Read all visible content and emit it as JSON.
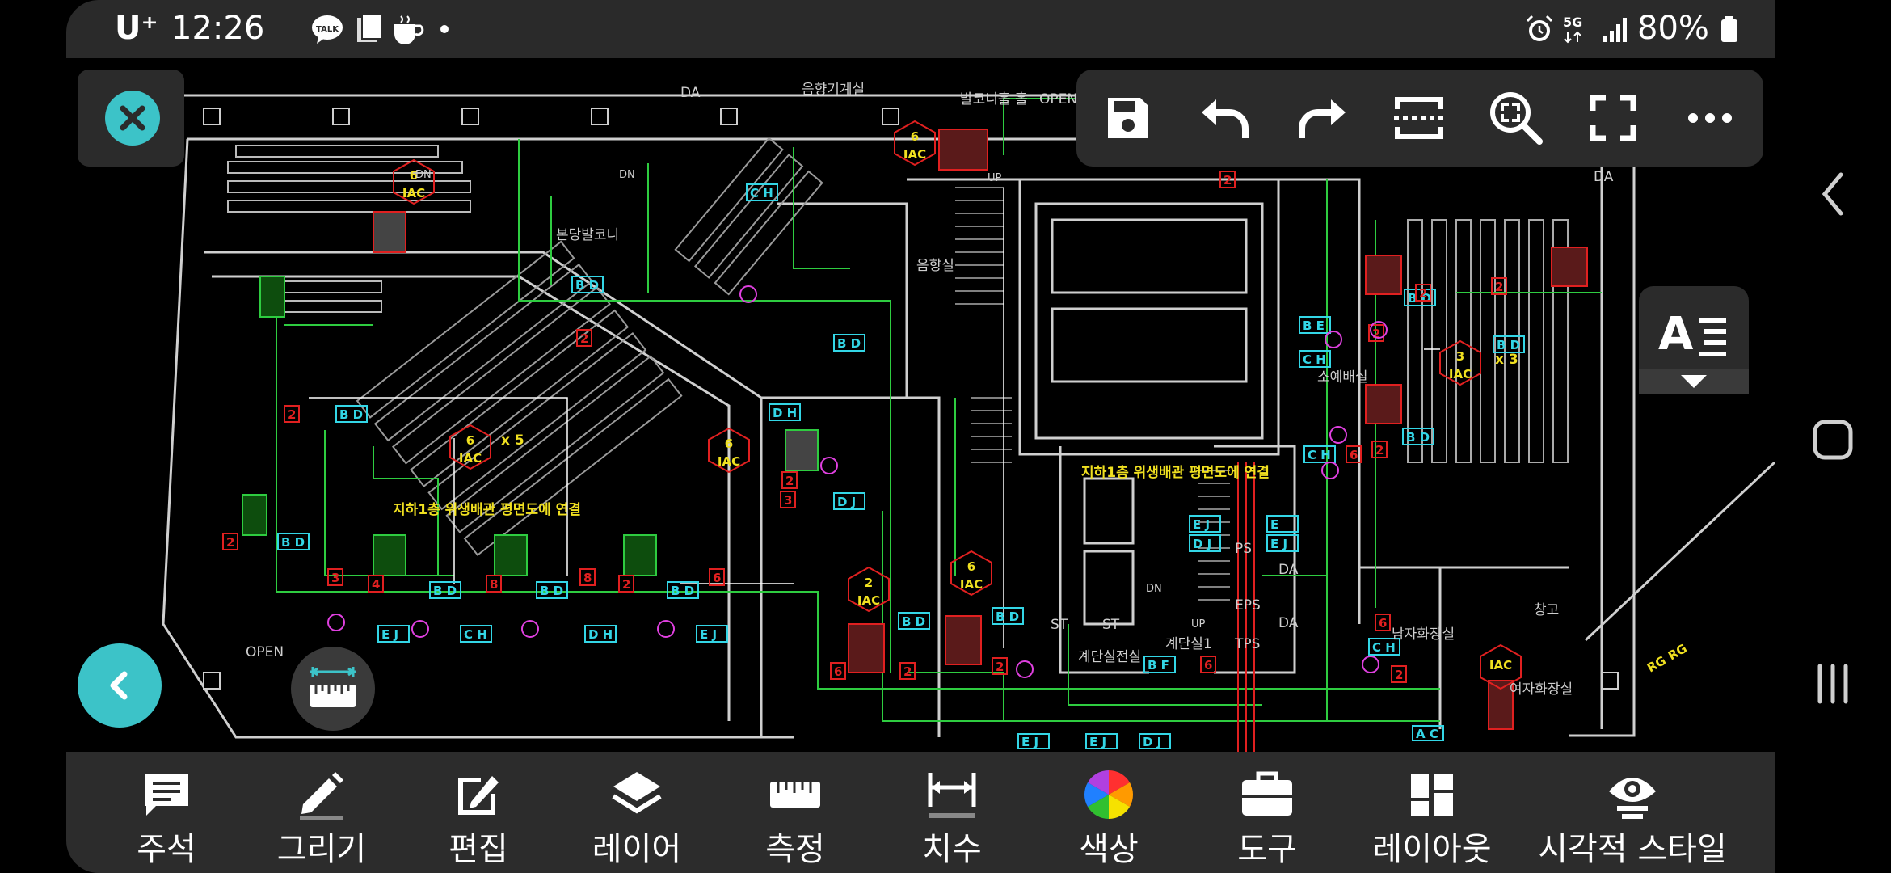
{
  "status_bar": {
    "carrier": "U⁺",
    "time": "12:26",
    "talk_badge": "TALK",
    "network": "5G",
    "battery": "80%"
  },
  "drawing": {
    "labels": {
      "da_top": "DA",
      "sound_control": "음향기계실",
      "balcony_hall": "발코니홀 홀",
      "open_top": "OPEN",
      "main_balcony": "본당발코니",
      "sound_room": "음향실",
      "link_note_left": "지하1층 위생배관 평면도에 연결",
      "link_note_center": "지하1층 위생배관 평면도에 연결",
      "x5": "x 5",
      "x3": "x 3",
      "open_bottom": "OPEN",
      "st1": "ST",
      "st2": "ST",
      "eps": "EPS",
      "tps": "TPS",
      "ps": "PS",
      "da_right": "DA",
      "da_r2": "DA",
      "da_r3": "DA",
      "stair_room": "계단실1",
      "power_room": "계단실전실",
      "water_room": "소예배실",
      "men_restroom": "남자화장실",
      "women_restroom": "여자화장실",
      "storage": "창고",
      "up": "UP",
      "dn": "DN",
      "iac": "IAC",
      "rg": "RG"
    }
  },
  "toolbar": {
    "save": "save",
    "undo": "undo",
    "redo": "redo",
    "fit": "fit-width",
    "zoom": "zoom-region",
    "fullscreen": "fullscreen",
    "more": "more"
  },
  "bottom_menu": [
    {
      "label": "주석",
      "icon": "comment-icon"
    },
    {
      "label": "그리기",
      "icon": "pencil-icon"
    },
    {
      "label": "편집",
      "icon": "edit-icon"
    },
    {
      "label": "레이어",
      "icon": "layers-icon"
    },
    {
      "label": "측정",
      "icon": "ruler-icon"
    },
    {
      "label": "치수",
      "icon": "dimension-icon"
    },
    {
      "label": "색상",
      "icon": "color-wheel-icon"
    },
    {
      "label": "도구",
      "icon": "toolbox-icon"
    },
    {
      "label": "레이아웃",
      "icon": "layout-icon"
    },
    {
      "label": "시각적 스타일",
      "icon": "visual-style-icon"
    }
  ],
  "colors": {
    "accent": "#3cc3c8",
    "panel": "#2b2b2b",
    "cad_green": "#2ecc40",
    "cad_red": "#e02020",
    "cad_cyan": "#33d6e6",
    "cad_yellow": "#f0e020",
    "cad_magenta": "#e040e0"
  }
}
